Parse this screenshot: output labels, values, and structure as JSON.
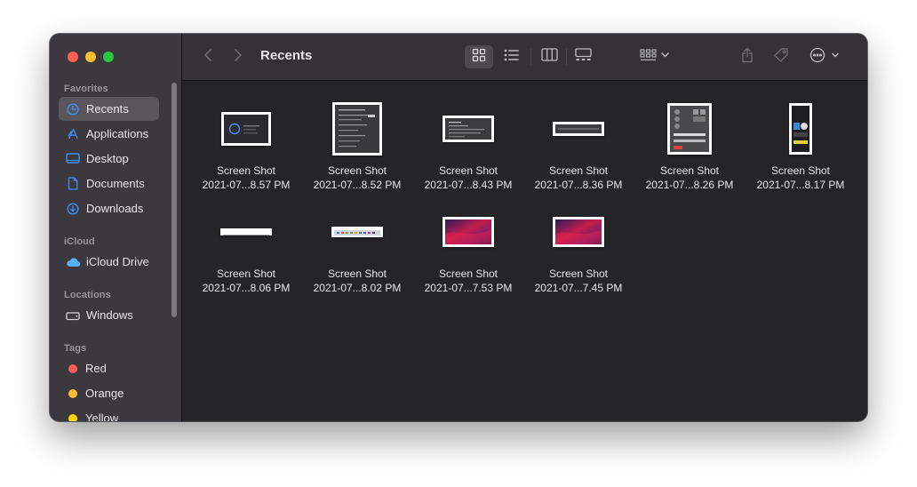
{
  "window": {
    "title": "Recents"
  },
  "sidebar": {
    "sections": {
      "favorites": "Favorites",
      "icloud": "iCloud",
      "locations": "Locations",
      "tags": "Tags"
    },
    "favorites": [
      {
        "label": "Recents",
        "icon": "clock-icon",
        "selected": true
      },
      {
        "label": "Applications",
        "icon": "applications-icon"
      },
      {
        "label": "Desktop",
        "icon": "desktop-icon"
      },
      {
        "label": "Documents",
        "icon": "document-icon"
      },
      {
        "label": "Downloads",
        "icon": "download-icon"
      }
    ],
    "icloud": [
      {
        "label": "iCloud Drive",
        "icon": "cloud-icon"
      }
    ],
    "locations": [
      {
        "label": "Windows",
        "icon": "drive-icon"
      }
    ],
    "tags": [
      {
        "label": "Red",
        "color": "#fe5f57"
      },
      {
        "label": "Orange",
        "color": "#febc2e"
      },
      {
        "label": "Yellow",
        "color": "#ffd60a"
      }
    ],
    "accent_color": "#3f8df7"
  },
  "toolbar": {
    "icons": [
      "chevron-left-icon",
      "chevron-right-icon",
      "grid-view-icon",
      "list-view-icon",
      "column-view-icon",
      "gallery-view-icon",
      "group-icon",
      "share-icon",
      "tag-icon",
      "more-icon",
      "search-icon"
    ],
    "active_view": "icon"
  },
  "files": [
    {
      "name": "Screen Shot",
      "date": "2021-07...8.57 PM"
    },
    {
      "name": "Screen Shot",
      "date": "2021-07...8.52 PM"
    },
    {
      "name": "Screen Shot",
      "date": "2021-07...8.43 PM"
    },
    {
      "name": "Screen Shot",
      "date": "2021-07...8.36 PM"
    },
    {
      "name": "Screen Shot",
      "date": "2021-07...8.26 PM"
    },
    {
      "name": "Screen Shot",
      "date": "2021-07...8.17 PM"
    },
    {
      "name": "Screen Shot",
      "date": "2021-07...8.06 PM"
    },
    {
      "name": "Screen Shot",
      "date": "2021-07...8.02 PM"
    },
    {
      "name": "Screen Shot",
      "date": "2021-07...7.53 PM"
    },
    {
      "name": "Screen Shot",
      "date": "2021-07...7.45 PM"
    }
  ]
}
